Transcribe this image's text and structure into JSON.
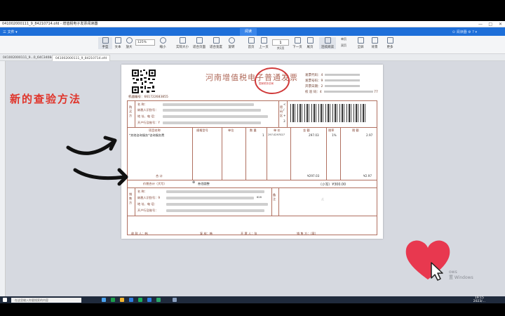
{
  "window": {
    "title": "041002000111_9_84210714.ofd - 增值税电子发票阅读器",
    "controls": [
      "—",
      "□",
      "✕"
    ]
  },
  "menu": {
    "file": "三 文件 ▾",
    "active_tab": "阅读",
    "right_text": "⊙ 阅读器 ⚙ ? ▾"
  },
  "toolbar": {
    "items": [
      "手型",
      "文本",
      "放大",
      "缩小",
      "实际大小",
      "适合页面",
      "适合宽度",
      "旋转",
      "首页",
      "上一页",
      "共1页",
      "下一页",
      "尾页",
      "连续阅读",
      "单页",
      "双页",
      "全屏",
      "背景",
      "更多"
    ],
    "zoom": "125%",
    "page": "1"
  },
  "tabs": [
    "041002000111_9...0_64C34084.ofd",
    "041002000111_9_84210714.ofd"
  ],
  "invoice": {
    "title": "河南增值税电子普通发票",
    "seal_text": "国家税务总局",
    "meta_labels": [
      "发票代码：4",
      "发票号码：9",
      "开票日期：2",
      "校 验 码：4"
    ],
    "meta_suffix": "77",
    "machine_no": "机器编号：661722683855",
    "buyer_side": "购买方",
    "buyer_fields": [
      "名 称：",
      "纳税人识别号：",
      "地 址、电 话：",
      "开户行及账号：Y"
    ],
    "password_area": "密码区",
    "cipher_marks": [
      "<",
      "/",
      "+",
      "3"
    ],
    "columns": [
      "项目名称",
      "规格型号",
      "单位",
      "数 量",
      "单 价",
      "金 额",
      "税率",
      "税 额"
    ],
    "item_name": "*其他咨询服务*咨询服务费",
    "quantity": "1",
    "unit_price": "297.0297027",
    "amount": "297.03",
    "tax_rate": "1%",
    "tax": "2.97",
    "total_label": "合 计",
    "total_amount": "¥297.03",
    "total_tax": "¥2.97",
    "grand_label": "价税合计（大写）",
    "grand_cn": "叁佰圆整",
    "grand_small": "（小写）¥300.00",
    "seller_side": "销售方",
    "seller_fields": [
      "名 称：",
      "纳税人识别号：9",
      "地 址、电 话：",
      "开户行及账号："
    ],
    "seller_suffix": "828",
    "remarks": "备注",
    "footer": [
      "收 款 人：韩",
      "复 核：韩",
      "开 票 人：张",
      "销 售 方：（章）"
    ]
  },
  "overlay": {
    "handwriting": "新的查验方法",
    "watermark_lines": [
      "ows",
      "置 Windows"
    ]
  },
  "taskbar": {
    "search_placeholder": "在这里输入你要搜索的内容",
    "time": "19:15",
    "date": "2023/..."
  },
  "colors": {
    "accent": "#1e6fd9",
    "invoice_line": "#b07060",
    "seal": "#d03a3a",
    "handwriting": "#e0342a",
    "heart": "#e8384f"
  }
}
